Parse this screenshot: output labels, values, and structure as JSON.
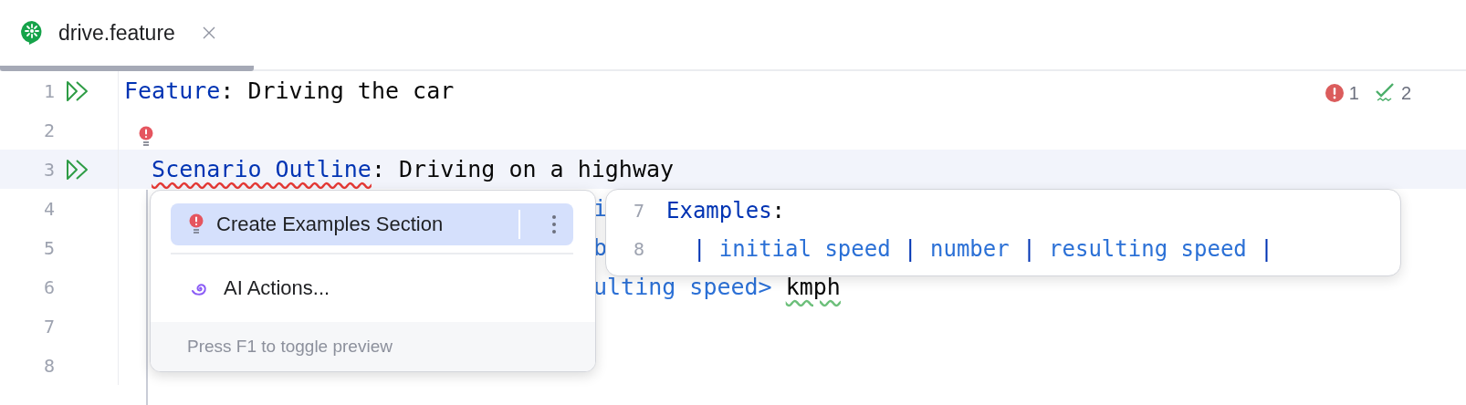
{
  "tabs": [
    {
      "label": "drive.feature",
      "selected": true
    }
  ],
  "inspections": {
    "errors": "1",
    "warnings": "2"
  },
  "lines": [
    {
      "number": "1",
      "run": true,
      "current": false,
      "tokens": [
        {
          "text": "Feature",
          "kind": "keyword"
        },
        {
          "text": ": Driving the car",
          "kind": "text"
        }
      ]
    },
    {
      "number": "2",
      "run": false,
      "current": false,
      "bulb": true
    },
    {
      "number": "3",
      "run": true,
      "current": true,
      "indented": true,
      "tokens": [
        {
          "text": "Scenario Outline",
          "kind": "keyword",
          "error": true
        },
        {
          "text": ": Driving on a highway",
          "kind": "text"
        }
      ]
    },
    {
      "number": "4",
      "run": false,
      "current": false,
      "partly_hidden": true,
      "tokens": [
        {
          "text": "i",
          "kind": "param"
        }
      ]
    },
    {
      "number": "5",
      "run": false,
      "current": false,
      "partly_hidden": true,
      "tokens": [
        {
          "text": "b",
          "kind": "param"
        }
      ]
    },
    {
      "number": "6",
      "run": false,
      "current": false,
      "partly_hidden": true,
      "tokens": [
        {
          "text": "ulting speed> ",
          "kind": "param"
        },
        {
          "text": "kmph",
          "kind": "text",
          "typo": true
        }
      ]
    },
    {
      "number": "7",
      "run": false,
      "current": false
    },
    {
      "number": "8",
      "run": false,
      "current": false
    }
  ],
  "intention_menu": {
    "items": [
      {
        "label": "Create Examples Section",
        "kind": "fix",
        "selected": true,
        "more": true
      },
      {
        "label": "AI Actions...",
        "kind": "ai",
        "selected": false,
        "more": false
      }
    ],
    "footer": "Press F1 to toggle preview"
  },
  "preview": {
    "lines": [
      {
        "number": "7",
        "tokens": [
          {
            "text": "Examples",
            "kind": "keyword"
          },
          {
            "text": ":",
            "kind": "text"
          }
        ]
      },
      {
        "number": "8",
        "indented": true,
        "tokens": [
          {
            "text": "|",
            "kind": "keyword"
          },
          {
            "text": " initial speed ",
            "kind": "param"
          },
          {
            "text": "|",
            "kind": "keyword"
          },
          {
            "text": " number ",
            "kind": "param"
          },
          {
            "text": "|",
            "kind": "keyword"
          },
          {
            "text": " resulting speed ",
            "kind": "param"
          },
          {
            "text": "|",
            "kind": "keyword"
          }
        ]
      }
    ]
  }
}
